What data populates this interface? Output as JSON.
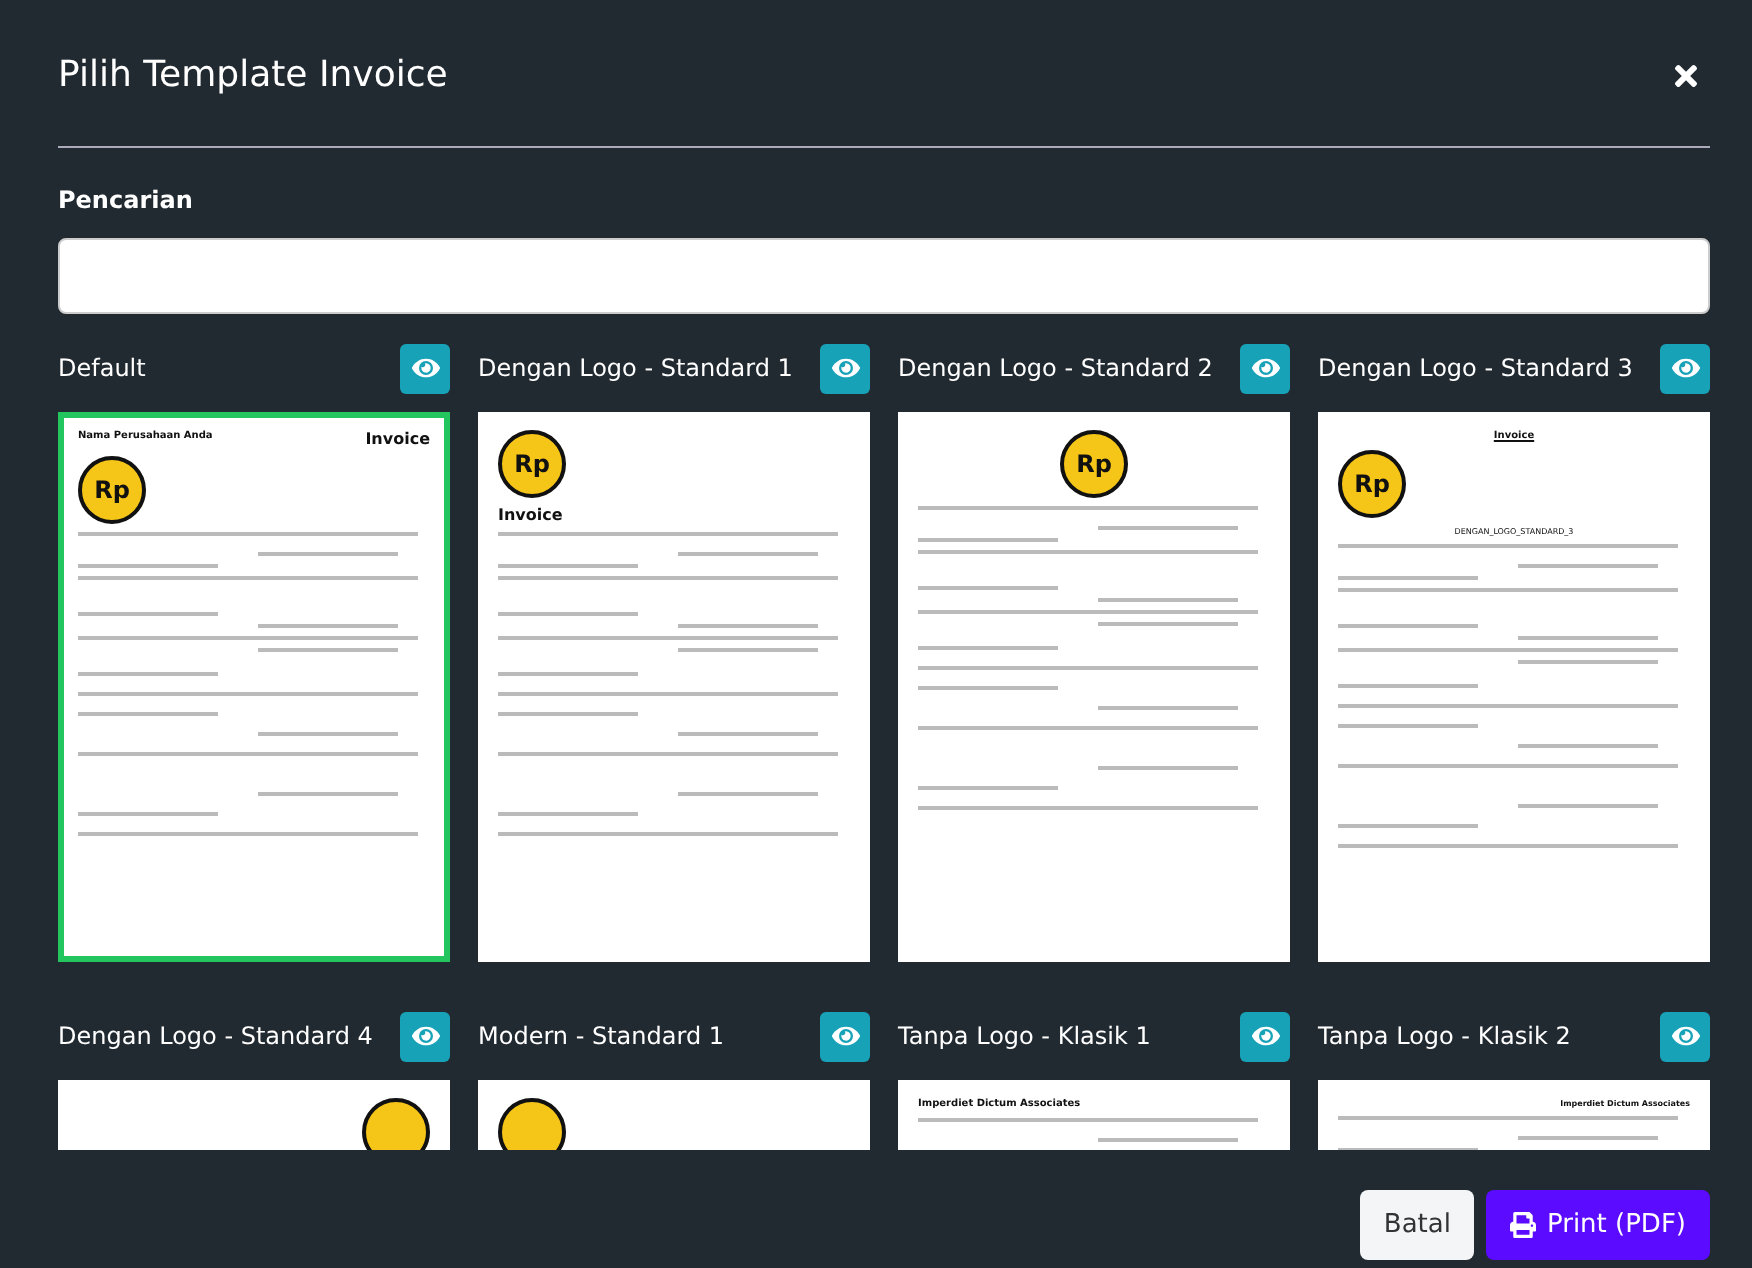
{
  "dialog": {
    "title": "Pilih Template Invoice"
  },
  "search": {
    "label": "Pencarian"
  },
  "templates": [
    {
      "name": "Default",
      "selected": true,
      "kind": "logo-left",
      "logo_text": "Rp",
      "texts": [
        {
          "kind": "company",
          "text": "Nama Perusahaan Anda"
        },
        {
          "kind": "title",
          "text": "Invoice"
        }
      ]
    },
    {
      "name": "Dengan Logo - Standard 1",
      "selected": false,
      "kind": "logo-left",
      "logo_text": "Rp",
      "texts": [
        {
          "kind": "title",
          "text": "Invoice"
        }
      ]
    },
    {
      "name": "Dengan Logo - Standard 2",
      "selected": false,
      "kind": "logo-center",
      "logo_text": "Rp"
    },
    {
      "name": "Dengan Logo - Standard 3",
      "selected": false,
      "kind": "logo-left",
      "logo_text": "Rp",
      "texts": [
        {
          "kind": "heading",
          "text": "Invoice"
        },
        {
          "kind": "reference",
          "text": "DENGAN_LOGO_STANDARD_3"
        }
      ]
    },
    {
      "name": "Dengan Logo - Standard 4",
      "selected": false,
      "kind": "logo-right"
    },
    {
      "name": "Modern - Standard 1",
      "selected": false,
      "kind": "logo-left"
    },
    {
      "name": "Tanpa Logo - Klasik 1",
      "selected": false,
      "kind": "plain",
      "texts": [
        {
          "kind": "company",
          "text": "Imperdiet Dictum Associates"
        }
      ]
    },
    {
      "name": "Tanpa Logo - Klasik 2",
      "selected": false,
      "kind": "plain",
      "texts": [
        {
          "kind": "company_right",
          "text": "Imperdiet Dictum Associates"
        }
      ]
    }
  ],
  "buttons": [
    {
      "kind": "cancel",
      "label": "Batal"
    },
    {
      "kind": "print",
      "label": "Print (PDF)"
    }
  ]
}
